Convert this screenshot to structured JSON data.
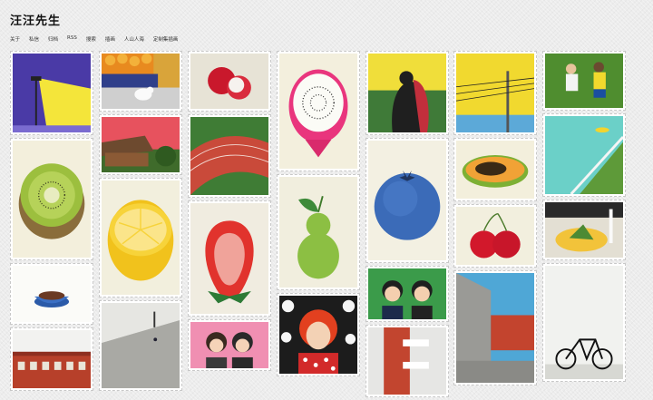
{
  "site": {
    "title": "汪汪先生"
  },
  "nav": {
    "items": [
      "关于",
      "私信",
      "归档",
      "RSS",
      "搜索",
      "插画",
      "人山人海",
      "定制集插画"
    ]
  },
  "gallery": {
    "columns": 7
  }
}
